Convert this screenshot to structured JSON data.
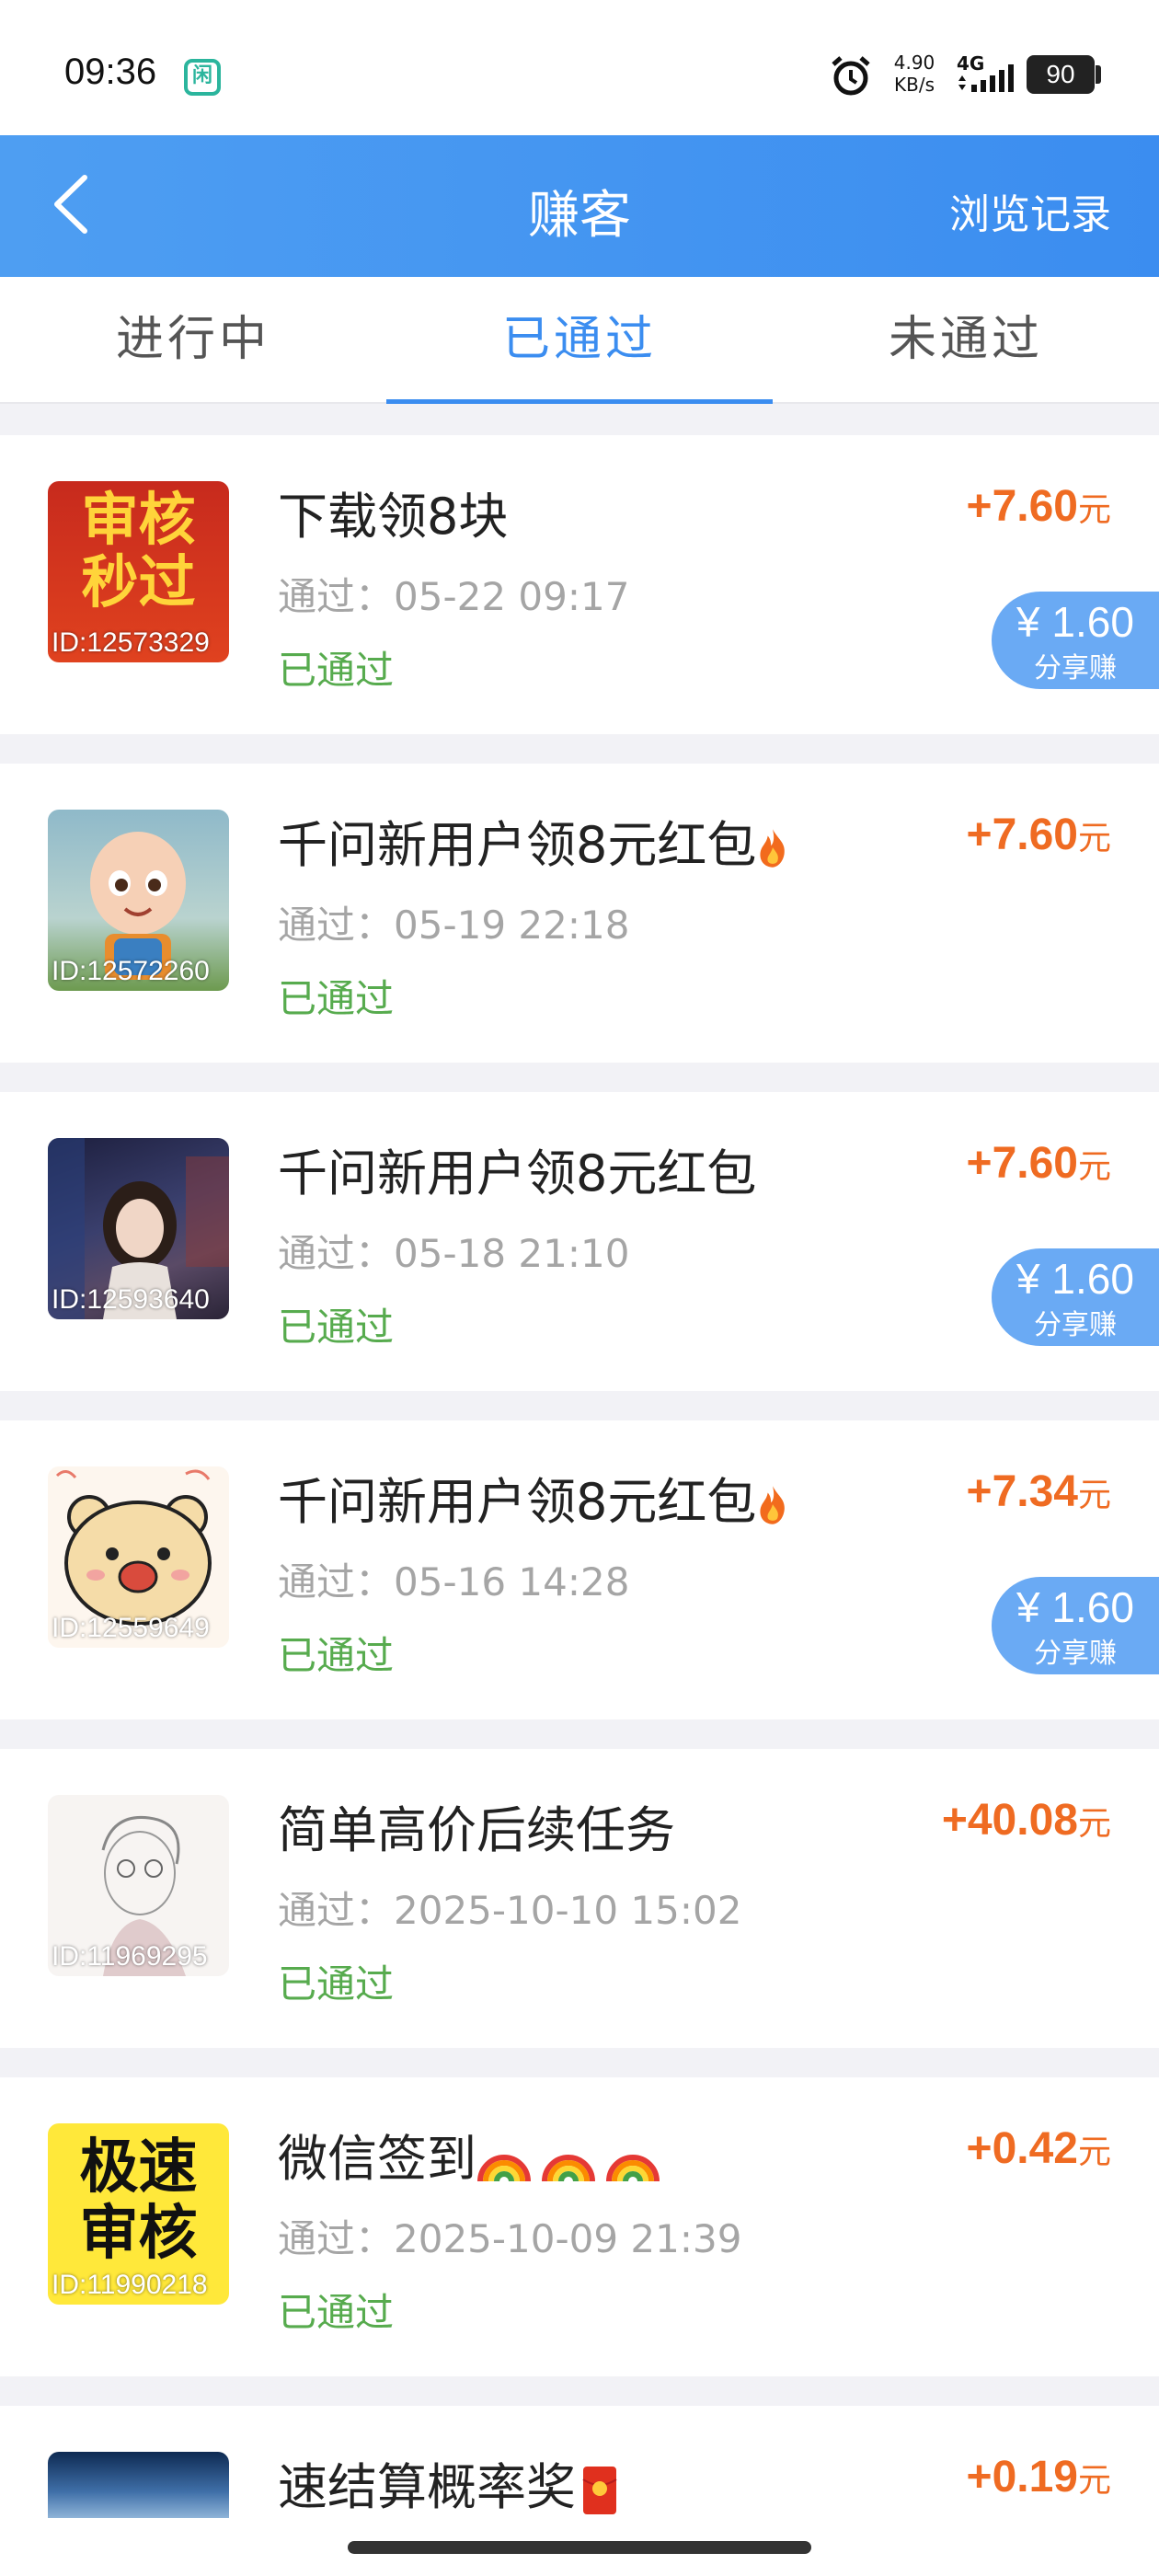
{
  "status_bar": {
    "time": "09:36",
    "app_icon_glyph": "闲",
    "speed_value": "4.90",
    "speed_unit": "KB/s",
    "network": "4G",
    "battery": "90"
  },
  "header": {
    "title": "赚客",
    "history_label": "浏览记录"
  },
  "tabs": [
    {
      "label": "进行中",
      "active": false
    },
    {
      "label": "已通过",
      "active": true
    },
    {
      "label": "未通过",
      "active": false
    }
  ],
  "tasks": [
    {
      "title": "下载领8块",
      "time": "通过：05-22 09:17",
      "status": "已通过",
      "reward": "+7.60",
      "reward_unit": "元",
      "thumb_id": "ID:12573329",
      "thumb_text": [
        "审核",
        "秒过"
      ],
      "share": {
        "amount": "¥ 1.60",
        "label": "分享赚"
      }
    },
    {
      "title": "千问新用户领8元红包",
      "title_icon": "fire-icon",
      "time": "通过：05-19 22:18",
      "status": "已通过",
      "reward": "+7.60",
      "reward_unit": "元",
      "thumb_id": "ID:12572260"
    },
    {
      "title": "千问新用户领8元红包",
      "time": "通过：05-18 21:10",
      "status": "已通过",
      "reward": "+7.60",
      "reward_unit": "元",
      "thumb_id": "ID:12593640",
      "share": {
        "amount": "¥ 1.60",
        "label": "分享赚"
      }
    },
    {
      "title": "千问新用户领8元红包",
      "title_icon": "fire-icon",
      "time": "通过：05-16 14:28",
      "status": "已通过",
      "reward": "+7.34",
      "reward_unit": "元",
      "thumb_id": "ID:12559649",
      "share": {
        "amount": "¥ 1.60",
        "label": "分享赚"
      }
    },
    {
      "title": "简单高价后续任务",
      "time": "通过：2025-10-10 15:02",
      "status": "已通过",
      "reward": "+40.08",
      "reward_unit": "元",
      "thumb_id": "ID:11969295"
    },
    {
      "title": "微信签到",
      "title_icon": "rainbow-icon",
      "time": "通过：2025-10-09 21:39",
      "status": "已通过",
      "reward": "+0.42",
      "reward_unit": "元",
      "thumb_id": "ID:11990218",
      "thumb_text": [
        "极速",
        "审核"
      ]
    },
    {
      "title": "速结算概率奖",
      "title_icon": "red-envelope-icon",
      "reward": "+0.19",
      "reward_unit": "元"
    }
  ]
}
